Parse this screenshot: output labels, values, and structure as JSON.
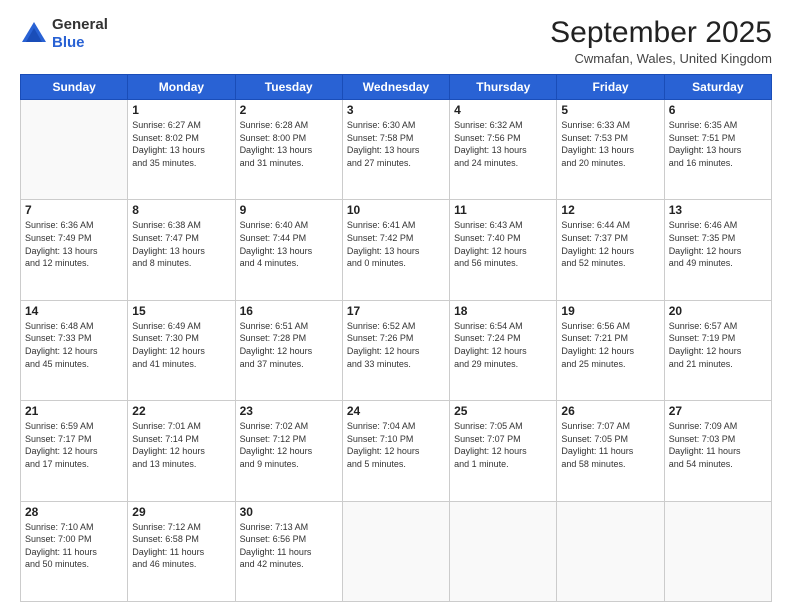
{
  "header": {
    "logo": {
      "line1": "General",
      "line2": "Blue"
    },
    "title": "September 2025",
    "location": "Cwmafan, Wales, United Kingdom"
  },
  "weekdays": [
    "Sunday",
    "Monday",
    "Tuesday",
    "Wednesday",
    "Thursday",
    "Friday",
    "Saturday"
  ],
  "weeks": [
    [
      {
        "day": "",
        "info": ""
      },
      {
        "day": "1",
        "info": "Sunrise: 6:27 AM\nSunset: 8:02 PM\nDaylight: 13 hours\nand 35 minutes."
      },
      {
        "day": "2",
        "info": "Sunrise: 6:28 AM\nSunset: 8:00 PM\nDaylight: 13 hours\nand 31 minutes."
      },
      {
        "day": "3",
        "info": "Sunrise: 6:30 AM\nSunset: 7:58 PM\nDaylight: 13 hours\nand 27 minutes."
      },
      {
        "day": "4",
        "info": "Sunrise: 6:32 AM\nSunset: 7:56 PM\nDaylight: 13 hours\nand 24 minutes."
      },
      {
        "day": "5",
        "info": "Sunrise: 6:33 AM\nSunset: 7:53 PM\nDaylight: 13 hours\nand 20 minutes."
      },
      {
        "day": "6",
        "info": "Sunrise: 6:35 AM\nSunset: 7:51 PM\nDaylight: 13 hours\nand 16 minutes."
      }
    ],
    [
      {
        "day": "7",
        "info": "Sunrise: 6:36 AM\nSunset: 7:49 PM\nDaylight: 13 hours\nand 12 minutes."
      },
      {
        "day": "8",
        "info": "Sunrise: 6:38 AM\nSunset: 7:47 PM\nDaylight: 13 hours\nand 8 minutes."
      },
      {
        "day": "9",
        "info": "Sunrise: 6:40 AM\nSunset: 7:44 PM\nDaylight: 13 hours\nand 4 minutes."
      },
      {
        "day": "10",
        "info": "Sunrise: 6:41 AM\nSunset: 7:42 PM\nDaylight: 13 hours\nand 0 minutes."
      },
      {
        "day": "11",
        "info": "Sunrise: 6:43 AM\nSunset: 7:40 PM\nDaylight: 12 hours\nand 56 minutes."
      },
      {
        "day": "12",
        "info": "Sunrise: 6:44 AM\nSunset: 7:37 PM\nDaylight: 12 hours\nand 52 minutes."
      },
      {
        "day": "13",
        "info": "Sunrise: 6:46 AM\nSunset: 7:35 PM\nDaylight: 12 hours\nand 49 minutes."
      }
    ],
    [
      {
        "day": "14",
        "info": "Sunrise: 6:48 AM\nSunset: 7:33 PM\nDaylight: 12 hours\nand 45 minutes."
      },
      {
        "day": "15",
        "info": "Sunrise: 6:49 AM\nSunset: 7:30 PM\nDaylight: 12 hours\nand 41 minutes."
      },
      {
        "day": "16",
        "info": "Sunrise: 6:51 AM\nSunset: 7:28 PM\nDaylight: 12 hours\nand 37 minutes."
      },
      {
        "day": "17",
        "info": "Sunrise: 6:52 AM\nSunset: 7:26 PM\nDaylight: 12 hours\nand 33 minutes."
      },
      {
        "day": "18",
        "info": "Sunrise: 6:54 AM\nSunset: 7:24 PM\nDaylight: 12 hours\nand 29 minutes."
      },
      {
        "day": "19",
        "info": "Sunrise: 6:56 AM\nSunset: 7:21 PM\nDaylight: 12 hours\nand 25 minutes."
      },
      {
        "day": "20",
        "info": "Sunrise: 6:57 AM\nSunset: 7:19 PM\nDaylight: 12 hours\nand 21 minutes."
      }
    ],
    [
      {
        "day": "21",
        "info": "Sunrise: 6:59 AM\nSunset: 7:17 PM\nDaylight: 12 hours\nand 17 minutes."
      },
      {
        "day": "22",
        "info": "Sunrise: 7:01 AM\nSunset: 7:14 PM\nDaylight: 12 hours\nand 13 minutes."
      },
      {
        "day": "23",
        "info": "Sunrise: 7:02 AM\nSunset: 7:12 PM\nDaylight: 12 hours\nand 9 minutes."
      },
      {
        "day": "24",
        "info": "Sunrise: 7:04 AM\nSunset: 7:10 PM\nDaylight: 12 hours\nand 5 minutes."
      },
      {
        "day": "25",
        "info": "Sunrise: 7:05 AM\nSunset: 7:07 PM\nDaylight: 12 hours\nand 1 minute."
      },
      {
        "day": "26",
        "info": "Sunrise: 7:07 AM\nSunset: 7:05 PM\nDaylight: 11 hours\nand 58 minutes."
      },
      {
        "day": "27",
        "info": "Sunrise: 7:09 AM\nSunset: 7:03 PM\nDaylight: 11 hours\nand 54 minutes."
      }
    ],
    [
      {
        "day": "28",
        "info": "Sunrise: 7:10 AM\nSunset: 7:00 PM\nDaylight: 11 hours\nand 50 minutes."
      },
      {
        "day": "29",
        "info": "Sunrise: 7:12 AM\nSunset: 6:58 PM\nDaylight: 11 hours\nand 46 minutes."
      },
      {
        "day": "30",
        "info": "Sunrise: 7:13 AM\nSunset: 6:56 PM\nDaylight: 11 hours\nand 42 minutes."
      },
      {
        "day": "",
        "info": ""
      },
      {
        "day": "",
        "info": ""
      },
      {
        "day": "",
        "info": ""
      },
      {
        "day": "",
        "info": ""
      }
    ]
  ]
}
